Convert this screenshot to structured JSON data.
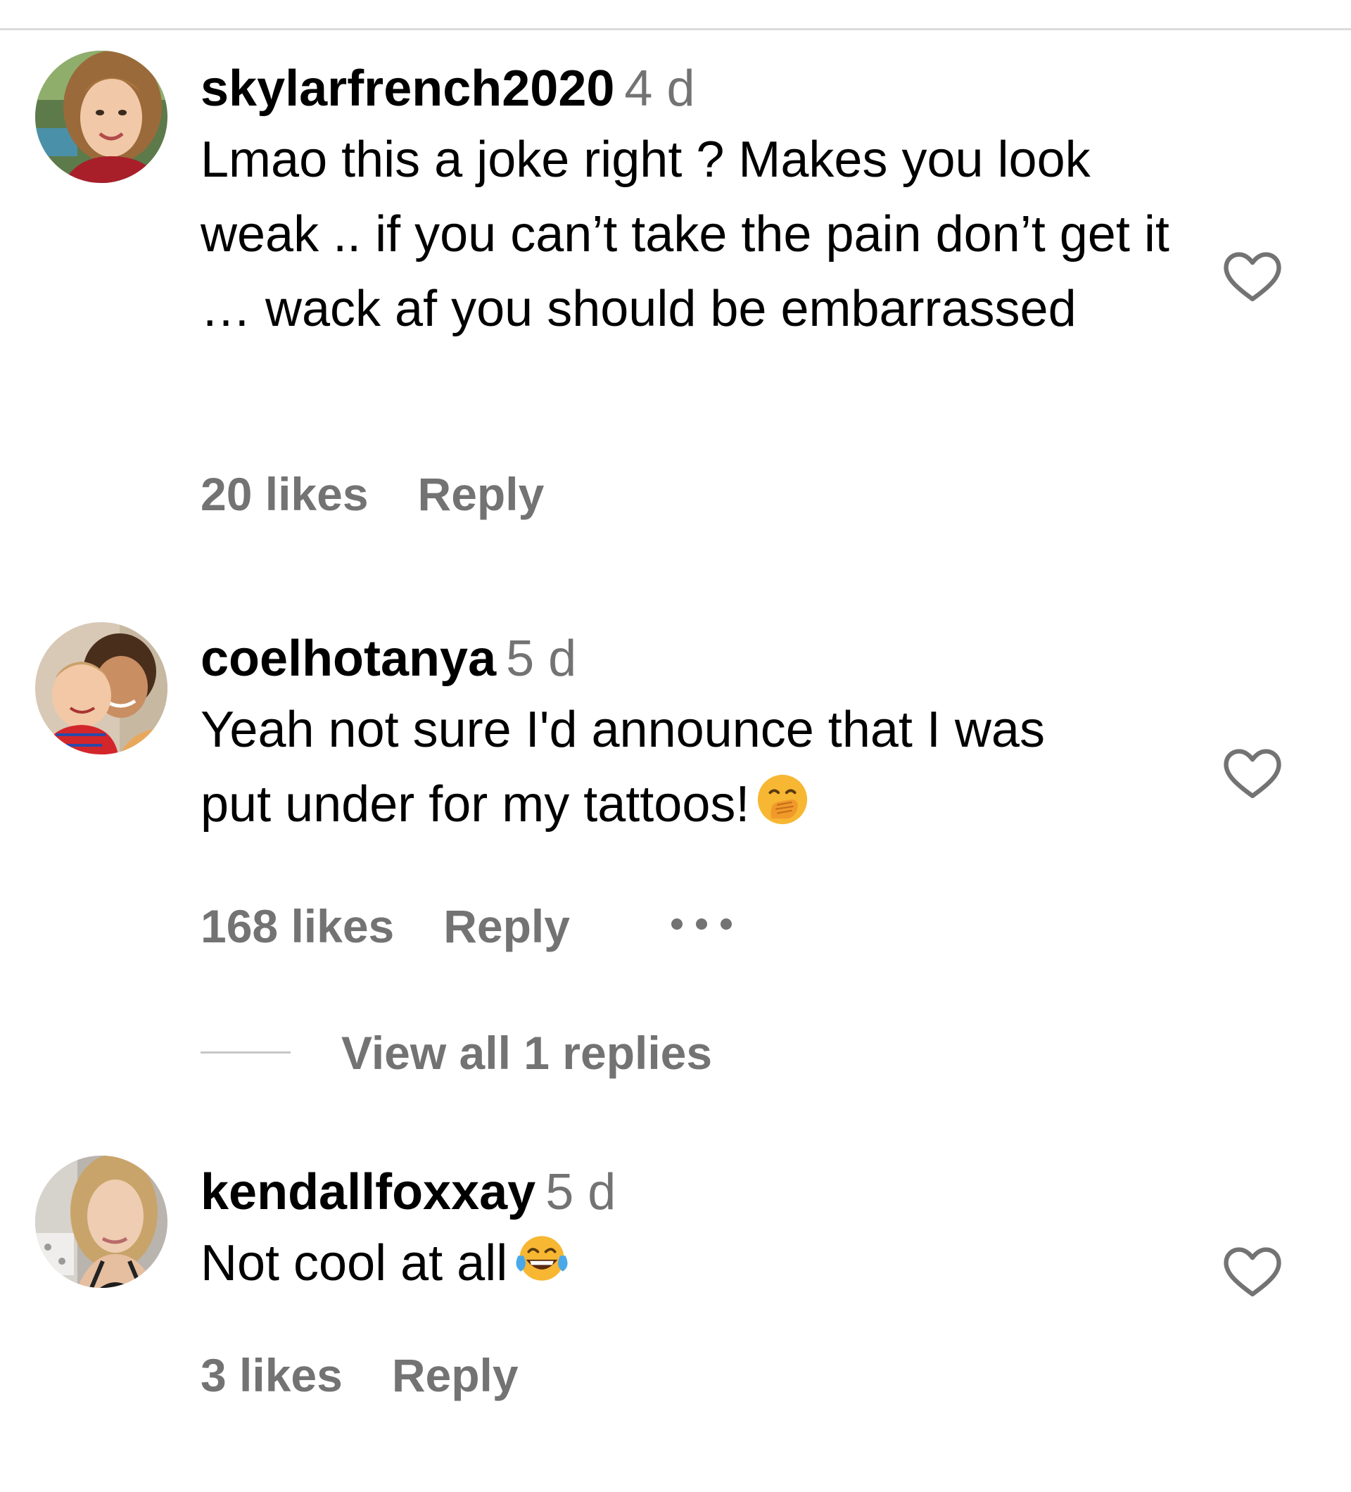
{
  "comments": [
    {
      "username": "skylarfrench2020",
      "time": "4 d",
      "text": "Lmao this a joke right ? Makes you look weak .. if you can’t take the pain don’t get it … wack af you should be embarrassed",
      "likes": "20 likes",
      "reply_label": "Reply",
      "avatar_icon": "profile-photo",
      "like_icon": "heart-outline-icon"
    },
    {
      "username": "coelhotanya",
      "time": "5 d",
      "text": "Yeah not sure I'd announce that I was put under for my tattoos!",
      "emoji": "🤭",
      "emoji_icon": "face-with-hand-over-mouth-icon",
      "likes": "168 likes",
      "reply_label": "Reply",
      "more_label": "•••",
      "view_replies_label": "View all 1 replies",
      "avatar_icon": "profile-photo",
      "like_icon": "heart-outline-icon"
    },
    {
      "username": "kendallfoxxay",
      "time": "5 d",
      "text": "Not cool at all",
      "emoji": "😂",
      "emoji_icon": "face-with-tears-of-joy-icon",
      "likes": "3 likes",
      "reply_label": "Reply",
      "avatar_icon": "profile-photo",
      "like_icon": "heart-outline-icon"
    }
  ],
  "colors": {
    "text": "#000000",
    "secondary": "#737373",
    "divider": "#dbdbdb",
    "emoji_yellow": "#f7b733"
  }
}
